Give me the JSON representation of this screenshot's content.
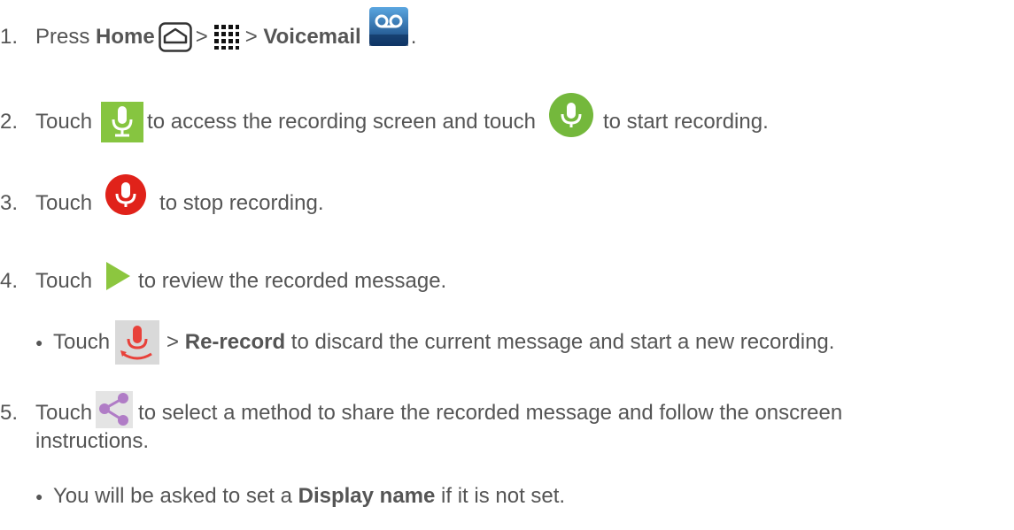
{
  "steps": [
    {
      "number": "1.",
      "parts": {
        "press": "Press",
        "home": "Home",
        "sep1": ">",
        "sep2": ">",
        "voicemail": "Voicemail",
        "end": "."
      },
      "icons": [
        "home-key-icon",
        "apps-grid-icon",
        "voicemail-app-icon"
      ]
    },
    {
      "number": "2.",
      "parts": {
        "touch": "Touch",
        "mid": "to access the recording screen and touch",
        "end": "to start recording."
      },
      "icons": [
        "record-screen-mic-icon",
        "start-recording-mic-icon"
      ]
    },
    {
      "number": "3.",
      "parts": {
        "touch": "Touch",
        "end": "to stop recording."
      },
      "icons": [
        "stop-recording-mic-icon"
      ]
    },
    {
      "number": "4.",
      "parts": {
        "touch": "Touch",
        "end": "to review the recorded message."
      },
      "icons": [
        "play-icon"
      ],
      "sub": {
        "bullet": "●",
        "touch": "Touch",
        "sep": ">",
        "rerecord": "Re-record",
        "end": "to discard the current message and start a new recording."
      }
    },
    {
      "number": "5.",
      "parts": {
        "touch": "Touch",
        "end": "to select a method to share the recorded message and follow the onscreen",
        "cont": "instructions."
      },
      "icons": [
        "share-icon"
      ],
      "sub": {
        "bullet": "●",
        "pre": "You will be asked to set a",
        "display_name": "Display name",
        "end": "if it is not set."
      }
    }
  ],
  "colors": {
    "text": "#555555",
    "mic_green": "#7cc242",
    "record_red": "#e2231a",
    "play_green": "#8cc63f",
    "share_purple": "#b07cc6",
    "voicemail_blue": "#1f6fb2"
  }
}
